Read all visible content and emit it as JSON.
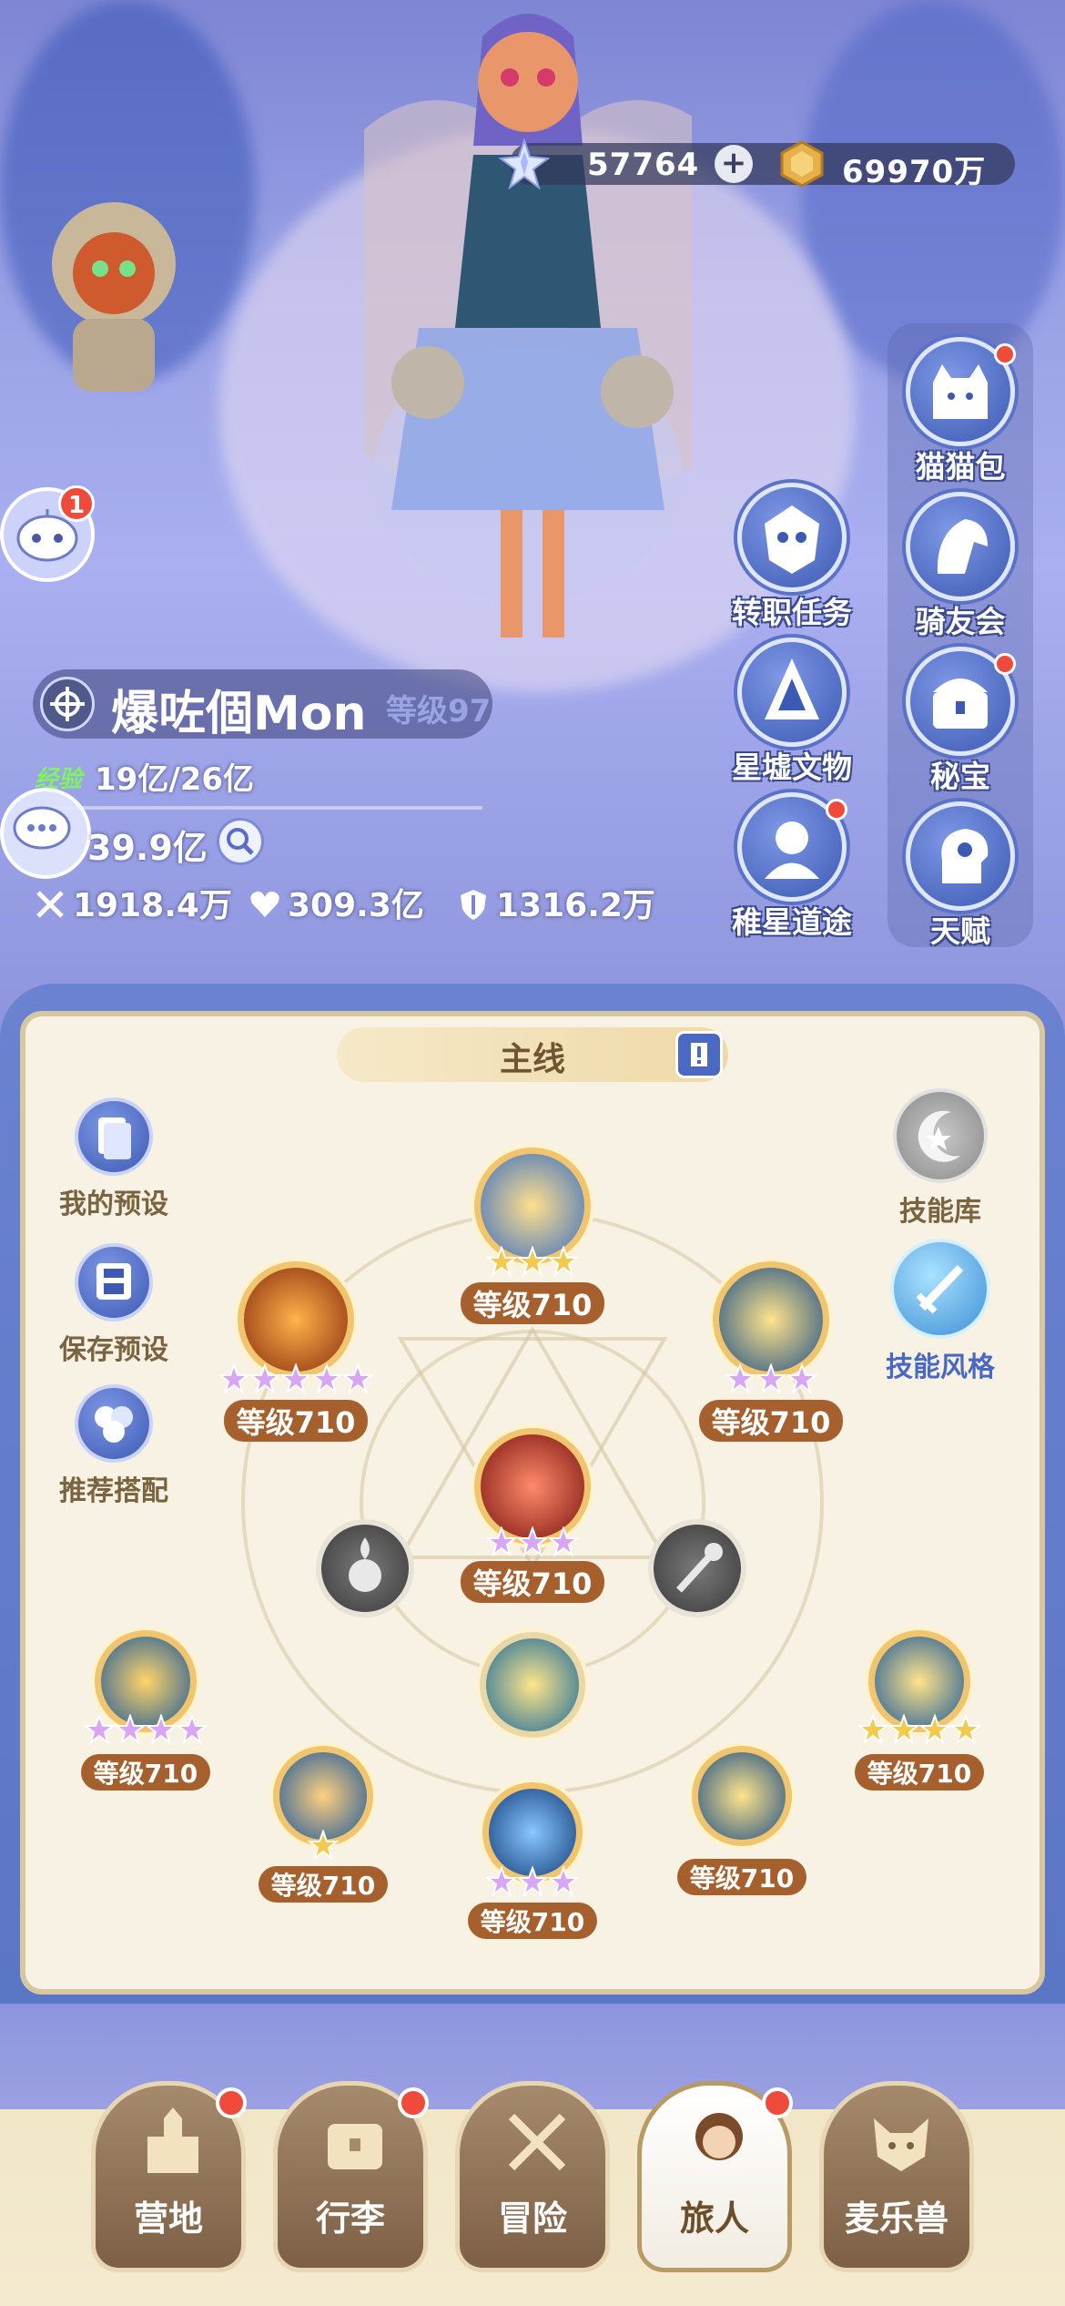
{
  "currency": {
    "crystals": "57764",
    "plus": "+",
    "gold": "69970万"
  },
  "side_menu": {
    "left_col": [
      {
        "label": "转职任务",
        "icon": "mask-icon"
      },
      {
        "label": "星墟文物",
        "icon": "relic-icon"
      },
      {
        "label": "稚星道途",
        "icon": "path-icon"
      }
    ],
    "right_col": [
      {
        "label": "猫猫包",
        "icon": "cat-bag-icon"
      },
      {
        "label": "骑友会",
        "icon": "horse-icon"
      },
      {
        "label": "秘宝",
        "icon": "treasure-icon"
      },
      {
        "label": "天赋",
        "icon": "talent-icon"
      }
    ]
  },
  "notifications": {
    "robot_badge": "1"
  },
  "player": {
    "name": "爆咗個Mon",
    "level": "等级97",
    "exp_tag": "经验",
    "exp": "19亿/26亿",
    "power": "39.9亿",
    "attack": "1918.4万",
    "hp": "309.3亿",
    "defense": "1316.2万"
  },
  "panel": {
    "tab_label": "主线",
    "left_buttons": [
      "我的预设",
      "保存预设",
      "推荐搭配"
    ],
    "right_buttons": [
      "技能库",
      "技能风格"
    ]
  },
  "skills": [
    {
      "id": "top",
      "level": "等级710",
      "stars": 3,
      "star_color": "gold"
    },
    {
      "id": "left-eye",
      "level": "等级710",
      "stars": 5,
      "star_color": "purple"
    },
    {
      "id": "right-blade",
      "level": "等级710",
      "stars": 3,
      "star_color": "purple"
    },
    {
      "id": "center-hand",
      "level": "等级710",
      "stars": 3,
      "star_color": "purple"
    },
    {
      "id": "far-left-drop",
      "level": "等级710",
      "stars": 4,
      "star_color": "purple"
    },
    {
      "id": "far-right-sword",
      "level": "等级710",
      "stars": 4,
      "star_color": "gold"
    },
    {
      "id": "bottom-left",
      "level": "等级710",
      "stars": 1,
      "star_color": "gold"
    },
    {
      "id": "bottom-center",
      "level": "等级710",
      "stars": 3,
      "star_color": "purple"
    },
    {
      "id": "bottom-right",
      "level": "等级710",
      "stars": 0,
      "star_color": "gold"
    }
  ],
  "nav": [
    {
      "label": "营地",
      "icon": "castle-icon",
      "dot": true,
      "active": false
    },
    {
      "label": "行李",
      "icon": "chest-icon",
      "dot": true,
      "active": false
    },
    {
      "label": "冒险",
      "icon": "swords-icon",
      "dot": false,
      "active": false
    },
    {
      "label": "旅人",
      "icon": "traveler-icon",
      "dot": true,
      "active": true
    },
    {
      "label": "麦乐兽",
      "icon": "fox-icon",
      "dot": false,
      "active": false
    }
  ],
  "colors": {
    "accent_blue": "#4a69c2",
    "level_pill": "#a5602e",
    "gold_star": "#f3c94e",
    "purple_star": "#d9a6f5",
    "badge_red": "#f04b3a",
    "exp_green": "#7cf55e"
  }
}
